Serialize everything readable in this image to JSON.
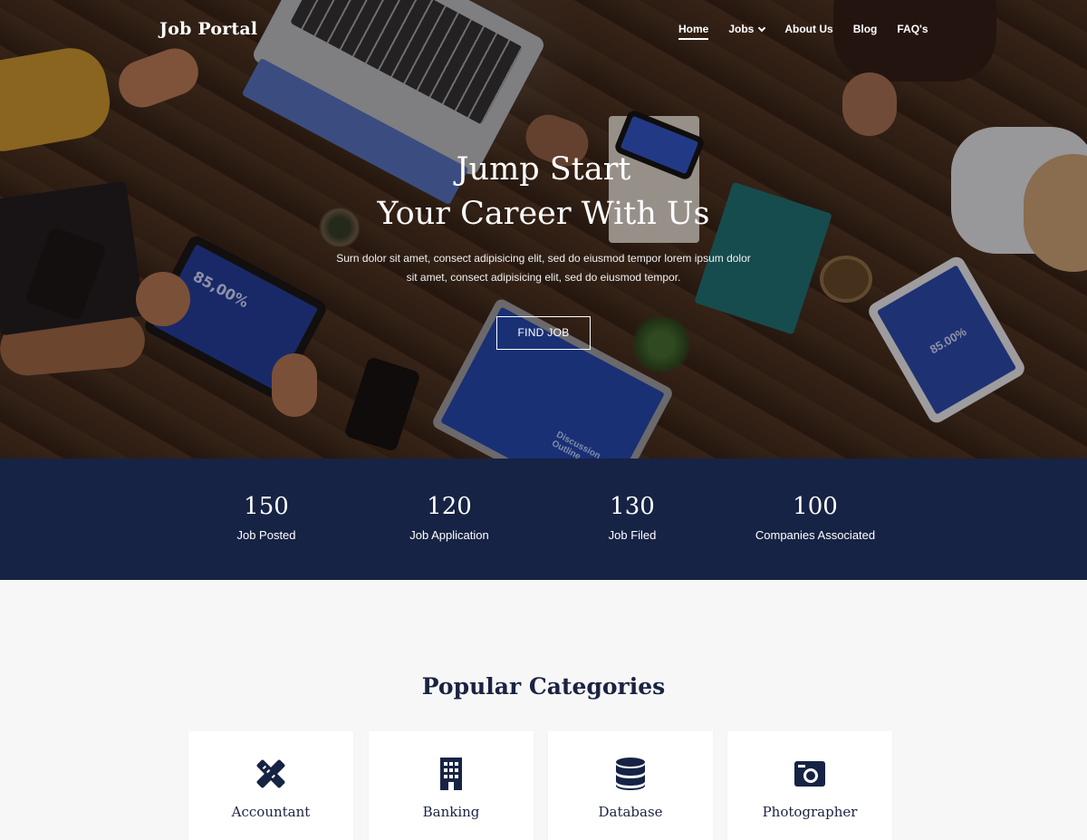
{
  "brand": {
    "logo": "Job Portal"
  },
  "nav": {
    "items": [
      {
        "label": "Home",
        "active": true
      },
      {
        "label": "Jobs",
        "has_dropdown": true
      },
      {
        "label": "About Us"
      },
      {
        "label": "Blog"
      },
      {
        "label": "FAQ's"
      }
    ]
  },
  "hero": {
    "title_line1": "Jump Start",
    "title_line2": "Your Career With Us",
    "subtitle": "Surn dolor sit amet, consect adipisicing elit, sed do eiusmod tempor lorem ipsum dolor sit amet, consect adipisicing elit, sed do eiusmod tempor.",
    "button": "FIND JOB",
    "image_texts": {
      "tablet_left": "85,00%",
      "laptop_mid": "Discussion Outline",
      "tablet_right": "85.00%"
    }
  },
  "stats": [
    {
      "value": "150",
      "label": "Job Posted"
    },
    {
      "value": "120",
      "label": "Job Application"
    },
    {
      "value": "130",
      "label": "Job Filed"
    },
    {
      "value": "100",
      "label": "Companies Associated"
    }
  ],
  "categories": {
    "title": "Popular Categories",
    "items": [
      {
        "label": "Accountant",
        "icon": "pencil-ruler-icon"
      },
      {
        "label": "Banking",
        "icon": "building-icon"
      },
      {
        "label": "Database",
        "icon": "database-icon"
      },
      {
        "label": "Photographer",
        "icon": "camera-icon"
      }
    ]
  },
  "colors": {
    "navy": "#162344",
    "heading": "#1a2341",
    "background": "#f7f7f8"
  }
}
